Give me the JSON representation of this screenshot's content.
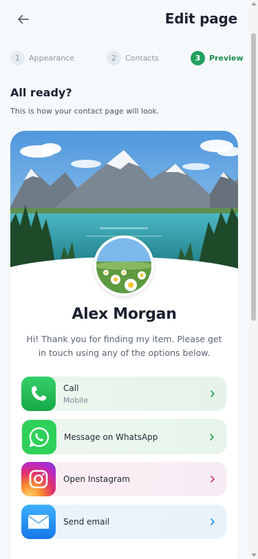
{
  "header": {
    "title": "Edit page",
    "back_icon": "arrow-left-icon"
  },
  "steps": [
    {
      "number": "1",
      "label": "Appearance",
      "active": false
    },
    {
      "number": "2",
      "label": "Contacts",
      "active": false
    },
    {
      "number": "3",
      "label": "Preview",
      "active": true
    }
  ],
  "intro": {
    "title": "All ready?",
    "subtitle": "This is how your contact page will look."
  },
  "card": {
    "name": "Alex Morgan",
    "message": "Hi! Thank you for finding my item. Please get in touch using any of the options below.",
    "actions": [
      {
        "label": "Call",
        "sublabel": "Mobile",
        "icon": "phone-icon"
      },
      {
        "label": "Message on WhatsApp",
        "icon": "whatsapp-icon"
      },
      {
        "label": "Open Instagram",
        "icon": "instagram-icon"
      },
      {
        "label": "Send email",
        "icon": "mail-icon"
      }
    ]
  },
  "colors": {
    "accent": "#22a05b",
    "call": "#1fb350",
    "whatsapp": "#2ed158",
    "instagram": "#e1306c",
    "email": "#1f8ef0"
  }
}
